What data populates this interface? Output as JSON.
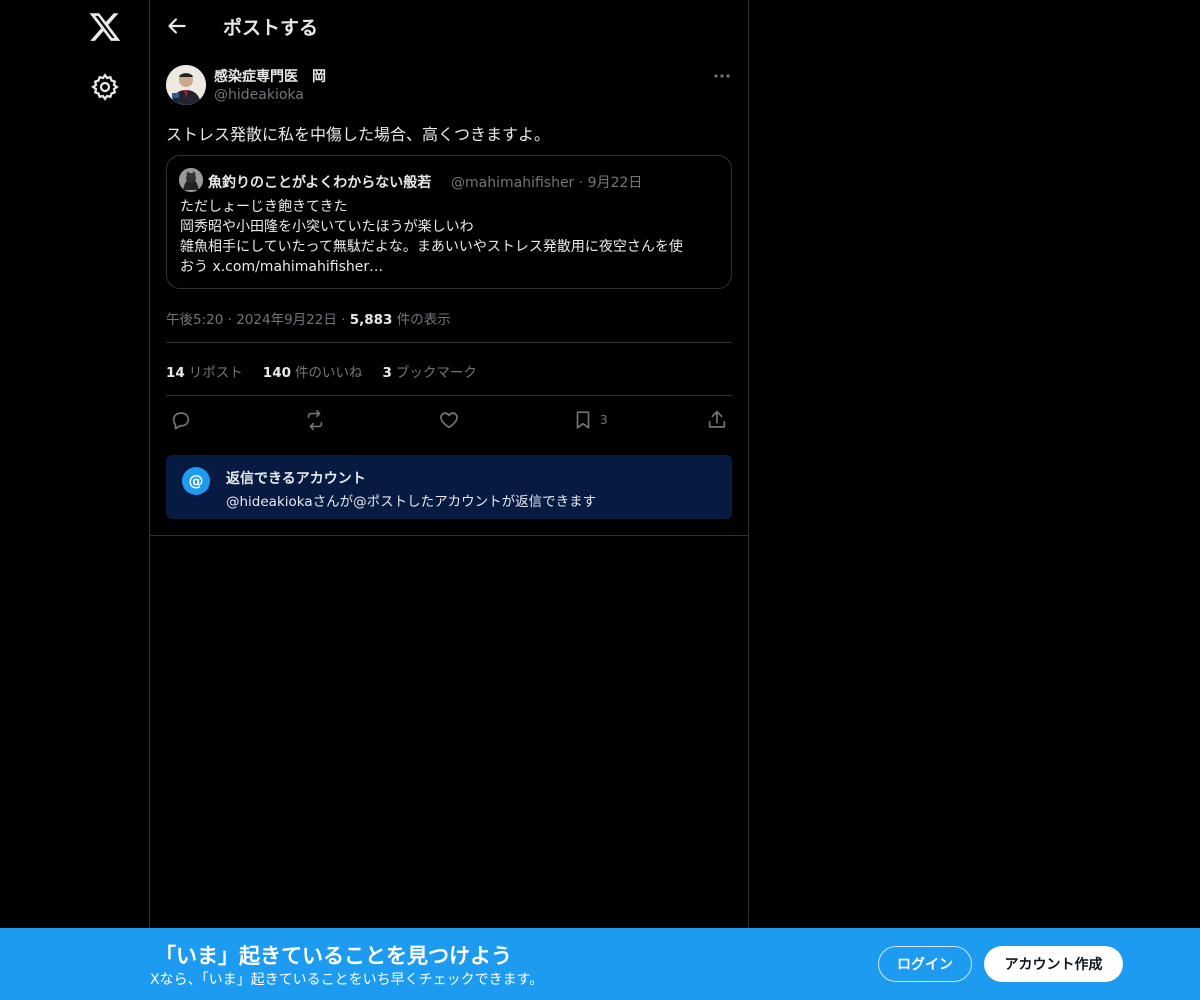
{
  "header": {
    "title": "ポストする"
  },
  "post": {
    "author_name": "感染症専門医　岡",
    "author_handle": "@hideakioka",
    "text": "ストレス発散に私を中傷した場合、高くつきますよ。",
    "quote": {
      "author_name": "魚釣りのことがよくわからない般若",
      "meta": "@mahimahifisher · 9月22日",
      "lines": [
        "ただしょーじき飽きてきた",
        "岡秀昭や小田隆を小突いていたほうが楽しいわ",
        "雑魚相手にしていたって無駄だよな。まあいいやストレス発散用に夜空さんを使",
        "おう x.com/mahimahifisher…"
      ]
    },
    "time": "午後5:20",
    "date": "2024年9月22日",
    "views_count": "5,883",
    "views_label": "件の表示",
    "stats": {
      "reposts_count": "14",
      "reposts_label": "リポスト",
      "likes_count": "140",
      "likes_label": "件のいいね",
      "bookmarks_count": "3",
      "bookmarks_label": "ブックマーク"
    },
    "bookmark_action_count": "3",
    "reply_restriction": {
      "title": "返信できるアカウント",
      "subtitle": "@hideakiokaさんが@ポストしたアカウントが返信できます"
    }
  },
  "banner": {
    "title": "「いま」起きていることを見つけよう",
    "subtitle": "Xなら、「いま」起きていることをいち早くチェックできます。",
    "login_label": "ログイン",
    "signup_label": "アカウント作成"
  },
  "icons": [
    "x-logo-icon",
    "gear-icon",
    "back-arrow-icon",
    "more-icon",
    "reply-icon",
    "repost-icon",
    "like-icon",
    "bookmark-icon",
    "share-icon",
    "at-icon"
  ],
  "colors": {
    "accent": "#1d9bf0",
    "background": "#000000",
    "muted_text": "#71767b",
    "border": "#2f3336"
  }
}
